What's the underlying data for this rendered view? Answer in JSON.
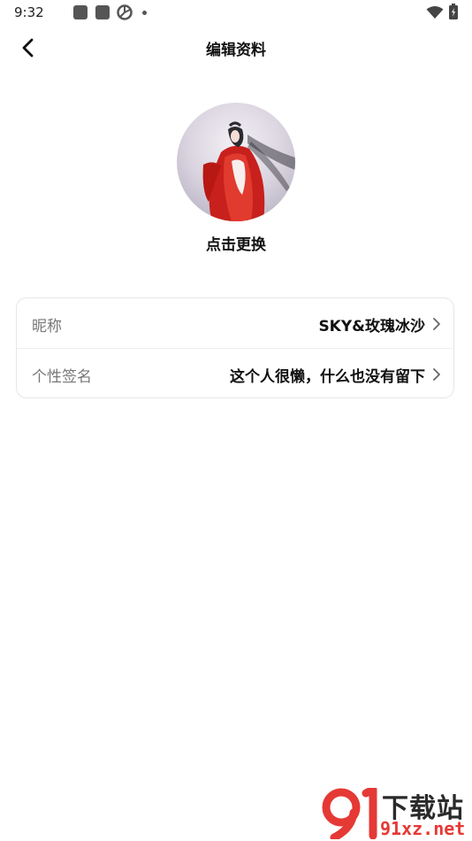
{
  "status_bar": {
    "time": "9:32",
    "icons": [
      "app-square-icon",
      "app-square-icon",
      "spinner-icon",
      "dot-icon",
      "wifi-icon",
      "battery-icon"
    ]
  },
  "header": {
    "title": "编辑资料",
    "back_icon": "chevron-left-icon"
  },
  "profile": {
    "change_label": "点击更换"
  },
  "fields": [
    {
      "label": "昵称",
      "value": "SKY&玫瑰冰沙"
    },
    {
      "label": "个性签名",
      "value": "这个人很懒，什么也没有留下"
    }
  ],
  "watermark": {
    "title": "下载站",
    "domain": "91xz.net"
  },
  "colors": {
    "background": "#ffffff",
    "label_gray": "#777777",
    "card_border": "#e6e6e6",
    "watermark_red": "#e53935"
  }
}
